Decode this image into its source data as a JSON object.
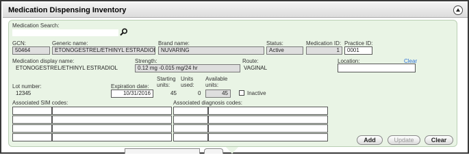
{
  "header": {
    "title": "Medication Dispensing Inventory"
  },
  "search": {
    "label": "Medication Search:",
    "value": ""
  },
  "row1": {
    "gcn_label": "GCN:",
    "gcn_value": "50464",
    "generic_label": "Generic name:",
    "generic_value": "ETONOGESTREL/ETHINYL ESTRADIOL",
    "brand_label": "Brand name:",
    "brand_value": "NUVARING",
    "status_label": "Status:",
    "status_value": "Active",
    "medid_label": "Medication ID:",
    "medid_value": "1",
    "practiceid_label": "Practice ID:",
    "practiceid_value": "0001"
  },
  "row2": {
    "display_label": "Medication display name:",
    "display_value": "ETONOGESTREL/ETHINYL ESTRADIOL",
    "strength_label": "Strength:",
    "strength_value": "0.12 mg -0.015 mg/24 hr",
    "route_label": "Route:",
    "route_value": "VAGINAL",
    "location_label": "Location:",
    "location_value": "",
    "clear_link": "Clear"
  },
  "row3": {
    "lot_label": "Lot number:",
    "lot_value": "12345",
    "exp_label": "Expiration date:",
    "exp_value": "10/31/2016",
    "starting_label_1": "Starting",
    "starting_label_2": "units:",
    "starting_value": "45",
    "used_label_1": "Units",
    "used_label_2": "used:",
    "used_value": "0",
    "available_label_1": "Available",
    "available_label_2": "units:",
    "available_value": "45",
    "inactive_label": "Inactive"
  },
  "codes": {
    "sim_label": "Associated SIM codes:",
    "diag_label": "Associated diagnosis codes:"
  },
  "buttons": {
    "add": "Add",
    "update": "Update",
    "clear": "Clear"
  }
}
